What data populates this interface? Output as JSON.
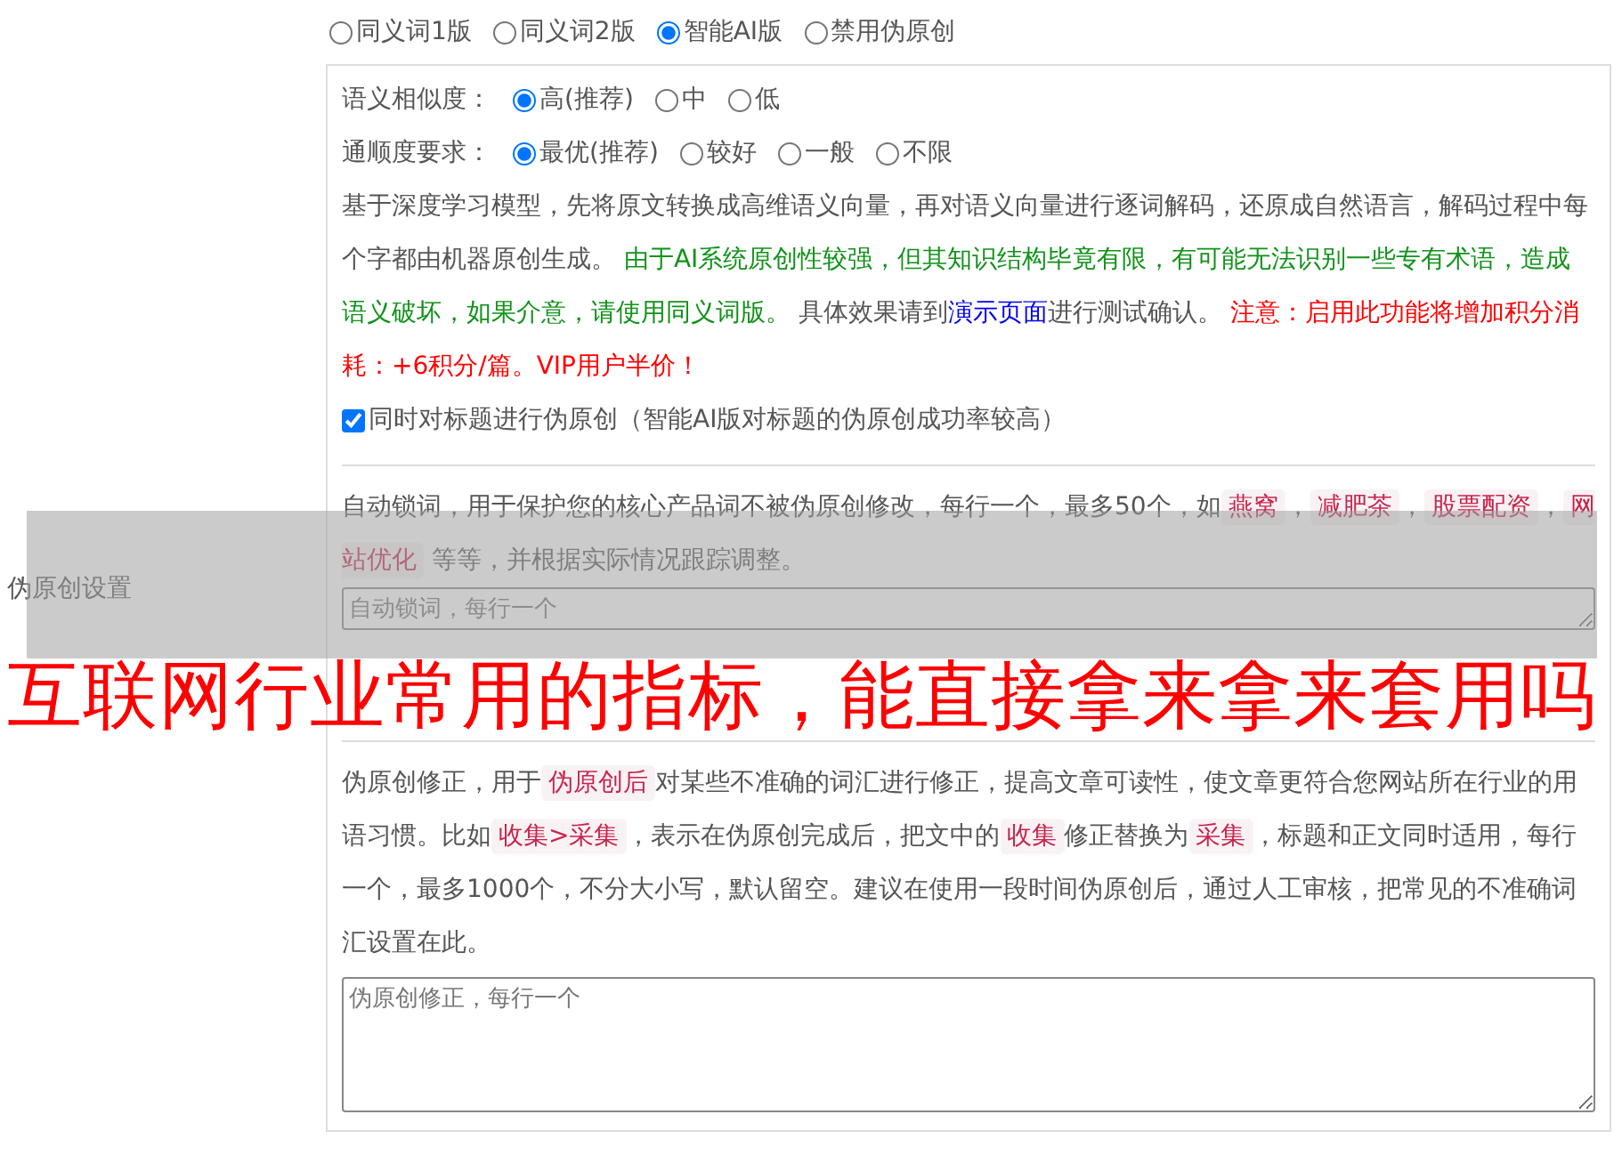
{
  "sidebar_label": "伪原创设置",
  "modes": [
    {
      "label": "同义词1版",
      "selected": false
    },
    {
      "label": "同义词2版",
      "selected": false
    },
    {
      "label": "智能AI版",
      "selected": true
    },
    {
      "label": "禁用伪原创",
      "selected": false
    }
  ],
  "similarity": {
    "label": "语义相似度：",
    "options": [
      {
        "label": "高(推荐)",
        "selected": true
      },
      {
        "label": "中",
        "selected": false
      },
      {
        "label": "低",
        "selected": false
      }
    ]
  },
  "fluency": {
    "label": "通顺度要求：",
    "options": [
      {
        "label": "最优(推荐)",
        "selected": true
      },
      {
        "label": "较好",
        "selected": false
      },
      {
        "label": "一般",
        "selected": false
      },
      {
        "label": "不限",
        "selected": false
      }
    ]
  },
  "ai_description": [
    {
      "kind": "text",
      "text": "基于深度学习模型，先将原文转换成高维语义向量，再对语义向量进行逐词解码，还原成自然语言，解码过程中每个字都由机器原创生成。 "
    },
    {
      "kind": "highlight",
      "text": "由于AI系统原创性较强，但其知识结构毕竟有限，有可能无法识别一些专有术语，造成语义破坏，如果介意，请使用同义词版。"
    },
    {
      "kind": "text",
      "text": " 具体效果请到"
    },
    {
      "kind": "link",
      "text": "演示页面"
    },
    {
      "kind": "text",
      "text": "进行测试确认。 "
    },
    {
      "kind": "warning",
      "text": "注意：启用此功能将增加积分消耗：+6积分/篇。VIP用户半价！"
    }
  ],
  "title_option": {
    "label": "同时对标题进行伪原创（智能AI版对标题的伪原创成功率较高）",
    "checked": true
  },
  "lock_words": {
    "description": [
      {
        "kind": "text",
        "text": "自动锁词，用于保护您的核心产品词不被伪原创修改，每行一个，最多50个，如"
      },
      {
        "kind": "tag",
        "text": "燕窝"
      },
      {
        "kind": "text",
        "text": "，"
      },
      {
        "kind": "tag",
        "text": "减肥茶"
      },
      {
        "kind": "text",
        "text": "，"
      },
      {
        "kind": "tag",
        "text": "股票配资"
      },
      {
        "kind": "text",
        "text": "，"
      },
      {
        "kind": "tag",
        "text": "网站优化"
      },
      {
        "kind": "text",
        "text": " 等等，并根据实际情况跟踪调整。"
      }
    ],
    "placeholder": "自动锁词，每行一个"
  },
  "corrections": {
    "description": [
      {
        "kind": "text",
        "text": "伪原创修正，用于"
      },
      {
        "kind": "tag",
        "text": "伪原创后"
      },
      {
        "kind": "text",
        "text": "对某些不准确的词汇进行修正，提高文章可读性，使文章更符合您网站所在行业的用语习惯。比如"
      },
      {
        "kind": "tag",
        "text": "收集>采集"
      },
      {
        "kind": "text",
        "text": "，表示在伪原创完成后，把文中的"
      },
      {
        "kind": "tag",
        "text": "收集"
      },
      {
        "kind": "text",
        "text": "修正替换为"
      },
      {
        "kind": "tag",
        "text": "采集"
      },
      {
        "kind": "text",
        "text": "，标题和正文同时适用，每行一个，最多1000个，不分大小写，默认留空。建议在使用一段时间伪原创后，通过人工审核，把常见的不准确词汇设置在此。"
      }
    ],
    "placeholder": "伪原创修正，每行一个"
  },
  "overlay_title": "互联网行业常用的指标，能直接拿来拿来套用吗"
}
